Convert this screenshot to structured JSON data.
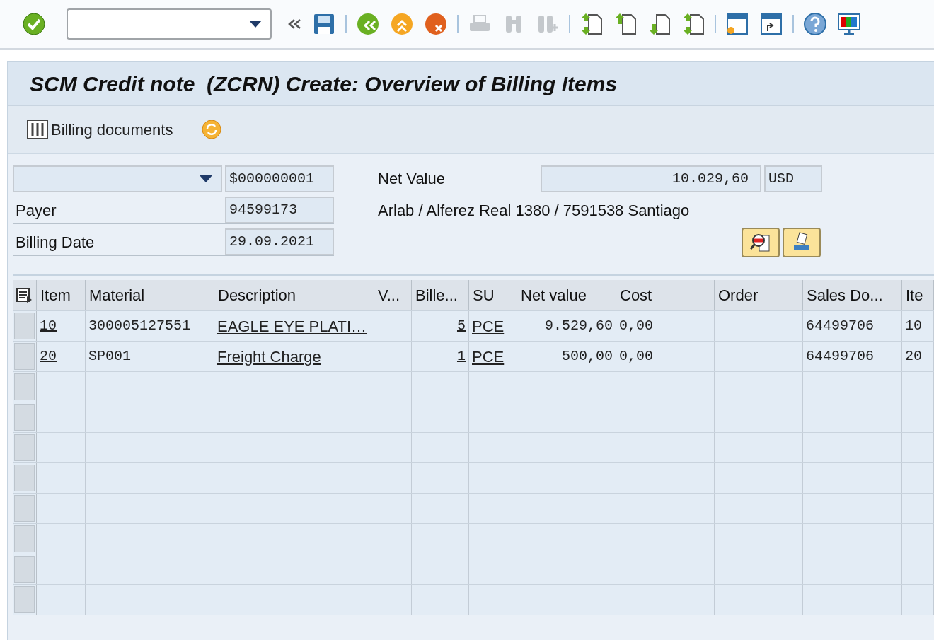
{
  "toolbar": [
    {
      "kind": "enter",
      "disabled": false
    },
    {
      "kind": "command-field",
      "disabled": false
    },
    {
      "kind": "collapse",
      "disabled": false
    },
    {
      "kind": "save",
      "disabled": false
    },
    {
      "kind": "back",
      "disabled": false
    },
    {
      "kind": "exit",
      "disabled": false
    },
    {
      "kind": "cancel",
      "disabled": false
    },
    {
      "kind": "print",
      "disabled": true
    },
    {
      "kind": "find",
      "disabled": true
    },
    {
      "kind": "find-next",
      "disabled": true
    },
    {
      "kind": "first-page",
      "disabled": false
    },
    {
      "kind": "previous-page",
      "disabled": false
    },
    {
      "kind": "next-page",
      "disabled": false
    },
    {
      "kind": "last-page",
      "disabled": false
    },
    {
      "kind": "new-session",
      "disabled": false
    },
    {
      "kind": "shortcut",
      "disabled": false
    },
    {
      "kind": "help",
      "disabled": false
    },
    {
      "kind": "layout",
      "disabled": false
    }
  ],
  "title": "SCM Credit note  (ZCRN) Create: Overview of Billing Items",
  "application_toolbar": {
    "billing_documents_button": "Billing documents"
  },
  "header": {
    "document_number": "$000000001",
    "net_value_label": "Net Value",
    "net_value": "10.029,60",
    "currency": "USD",
    "payer_label": "Payer",
    "payer": "94599173",
    "payer_address": "Arlab / Alferez Real 1380 / 7591538 Santiago",
    "billing_date_label": "Billing Date",
    "billing_date": "29.09.2021"
  },
  "table": {
    "columns": [
      "Item",
      "Material",
      "Description",
      "V...",
      "Bille...",
      "SU",
      "Net value",
      "Cost",
      "Order",
      "Sales Do...",
      "Ite"
    ],
    "rows": [
      {
        "item": "10",
        "material": "300005127551",
        "description": "EAGLE EYE PLATI…",
        "billed": "5",
        "su": "PCE",
        "net_value": "9.529,60",
        "cost": "0,00",
        "sales_document": "64499706",
        "sales_item": "10"
      },
      {
        "item": "20",
        "material": "SP001",
        "description": "Freight Charge",
        "billed": "1",
        "su": "PCE",
        "net_value": "500,00",
        "cost": "0,00",
        "sales_document": "64499706",
        "sales_item": "20"
      }
    ]
  }
}
